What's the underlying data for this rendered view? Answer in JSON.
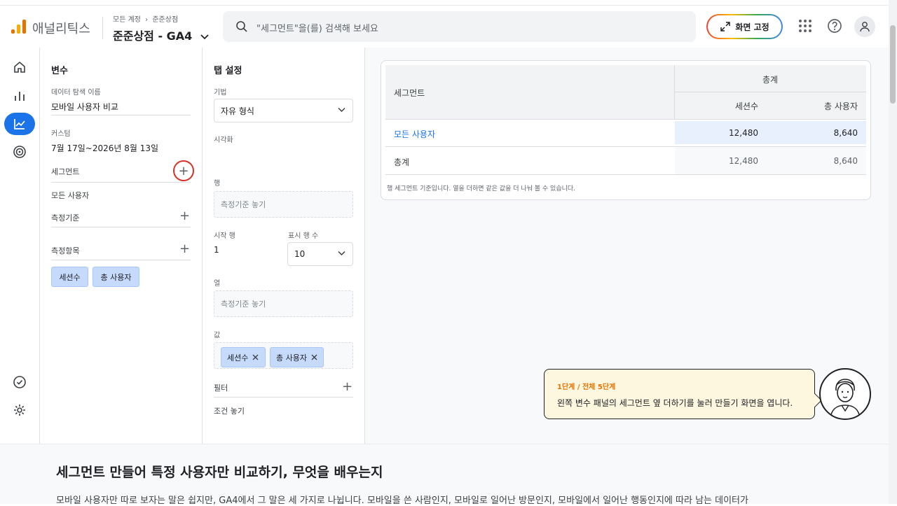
{
  "header": {
    "app_name": "애널리틱스",
    "breadcrumb_account": "모든 계정",
    "breadcrumb_sep": "›",
    "breadcrumb_property": "준준상점",
    "property_name": "준준상점 - GA4",
    "search_placeholder": "\"세그먼트\"을(를) 검색해 보세요",
    "pin_button_label": "화면 고정"
  },
  "colors": {
    "accent": "#1a73e8",
    "highlight_cell": "#e8f0fe",
    "step_label": "#e37400",
    "ring": "#d93025",
    "chip_bg": "#c6dafc"
  },
  "variables_panel": {
    "title": "변수",
    "exploration_name_label": "데이터 탐색 이름",
    "exploration_name_value": "모바일 사용자 비교",
    "date_label": "커스텀",
    "date_value": "7월 17일~2026년 8월 13일",
    "segments_label": "세그먼트",
    "segment_item": "모든 사용자",
    "dimensions_label": "측정기준",
    "metrics_label": "측정항목",
    "metric_chips": [
      "세션수",
      "총 사용자"
    ]
  },
  "tab_settings": {
    "title": "탭 설정",
    "technique_label": "기법",
    "technique_value": "자유 형식",
    "visualization_label": "시각화",
    "rows_label": "행",
    "rows_drop": "측정기준 놓기",
    "start_row_label": "시작 행",
    "start_row_value": "1",
    "show_rows_label": "표시 행 수",
    "show_rows_value": "10",
    "columns_label": "열",
    "columns_drop": "측정기준 놓기",
    "values_label": "값",
    "value_chips": [
      "세션수",
      "총 사용자"
    ],
    "filters_label": "필터",
    "filters_drop": "조건 놓기"
  },
  "table": {
    "segment_header": "세그먼트",
    "total_group_header": "총계",
    "col_sessions": "세션수",
    "col_users": "총 사용자",
    "rows": [
      {
        "label": "모든 사용자",
        "sessions": "12,480",
        "users": "8,640"
      },
      {
        "label": "총계",
        "sessions": "12,480",
        "users": "8,640"
      }
    ],
    "footnote": "행 세그먼트 기준입니다. 열을 더하면 같은 값을 더 나눠 볼 수 있습니다."
  },
  "tooltip": {
    "step": "1단계 / 전체 5단계",
    "message": "왼쪽 변수 패널의 세그먼트 옆 더하기를 눌러 만들기 화면을 엽니다."
  },
  "article": {
    "title": "세그먼트 만들어 특정 사용자만 비교하기, 무엇을 배우는지",
    "body": "모바일 사용자만 따로 보자는 말은 쉽지만, GA4에서 그 말은 세 가지로 나뉩니다. 모바일을 쓴 사람인지, 모바일로 일어난 방문인지, 모바일에서 일어난 행동인지에 따라 남는 데이터가"
  }
}
